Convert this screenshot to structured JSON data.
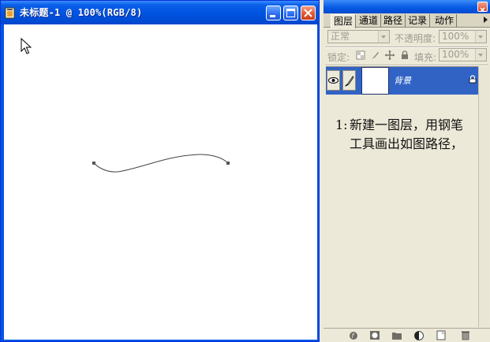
{
  "document_window": {
    "title": "未标题-1 @ 100%(RGB/8)",
    "buttons": {
      "minimize": "minimize-icon",
      "maximize": "maximize-icon",
      "close": "close-icon"
    },
    "colors": {
      "titlebar": "#0053e1",
      "close_button": "#e4572e",
      "canvas": "#ffffff"
    }
  },
  "layers_panel": {
    "tabs": [
      {
        "label": "图层",
        "active": true
      },
      {
        "label": "通道",
        "active": false
      },
      {
        "label": "路径",
        "active": false
      },
      {
        "label": "记录",
        "active": false
      },
      {
        "label": "动作",
        "active": false
      }
    ],
    "blend_mode": "正常",
    "opacity_label": "不透明度:",
    "opacity_value": "100%",
    "lock_label": "锁定:",
    "fill_label": "填充:",
    "fill_value": "100%",
    "layers": [
      {
        "name": "背景",
        "visible": true,
        "locked": true,
        "selected": true
      }
    ],
    "note_number": "1:",
    "note_text": "新建一图层，用钢笔工具画出如图路径，",
    "colors": {
      "selected_layer": "#3163c5",
      "panel_bg": "#ece9d8"
    },
    "bottom_icons": [
      "link-icon",
      "layer-style-icon",
      "mask-icon",
      "new-set-icon",
      "adjustment-layer-icon",
      "new-layer-icon",
      "trash-icon"
    ]
  }
}
